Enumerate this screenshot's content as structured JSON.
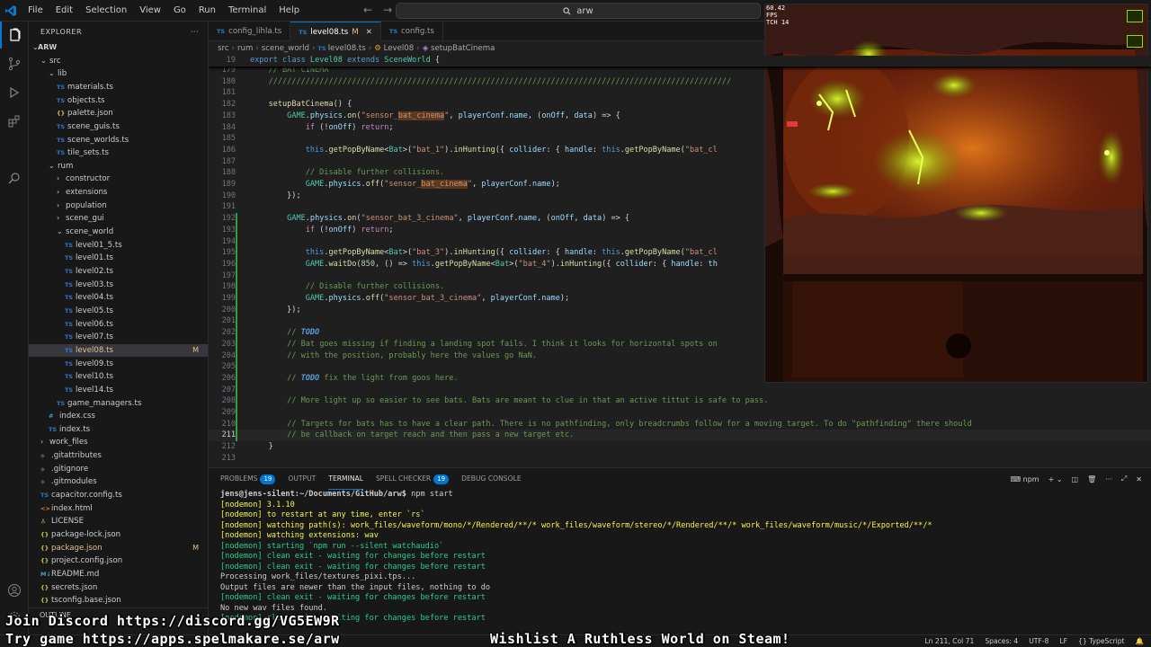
{
  "titlebar": {
    "menu": [
      "File",
      "Edit",
      "Selection",
      "View",
      "Go",
      "Run",
      "Terminal",
      "Help"
    ],
    "search_text": "arw"
  },
  "explorer": {
    "header": "EXPLORER",
    "root": "ARW",
    "items": [
      {
        "label": "src",
        "indent": 1,
        "type": "folder-open"
      },
      {
        "label": "lib",
        "indent": 2,
        "type": "folder-open"
      },
      {
        "label": "materials.ts",
        "indent": 3,
        "type": "ts"
      },
      {
        "label": "objects.ts",
        "indent": 3,
        "type": "ts"
      },
      {
        "label": "palette.json",
        "indent": 3,
        "type": "json"
      },
      {
        "label": "scene_guis.ts",
        "indent": 3,
        "type": "ts"
      },
      {
        "label": "scene_worlds.ts",
        "indent": 3,
        "type": "ts"
      },
      {
        "label": "tile_sets.ts",
        "indent": 3,
        "type": "ts"
      },
      {
        "label": "rum",
        "indent": 2,
        "type": "folder-open"
      },
      {
        "label": "constructor",
        "indent": 3,
        "type": "folder"
      },
      {
        "label": "extensions",
        "indent": 3,
        "type": "folder"
      },
      {
        "label": "population",
        "indent": 3,
        "type": "folder"
      },
      {
        "label": "scene_gui",
        "indent": 3,
        "type": "folder"
      },
      {
        "label": "scene_world",
        "indent": 3,
        "type": "folder-open"
      },
      {
        "label": "level01_5.ts",
        "indent": 4,
        "type": "ts"
      },
      {
        "label": "level01.ts",
        "indent": 4,
        "type": "ts"
      },
      {
        "label": "level02.ts",
        "indent": 4,
        "type": "ts"
      },
      {
        "label": "level03.ts",
        "indent": 4,
        "type": "ts"
      },
      {
        "label": "level04.ts",
        "indent": 4,
        "type": "ts"
      },
      {
        "label": "level05.ts",
        "indent": 4,
        "type": "ts"
      },
      {
        "label": "level06.ts",
        "indent": 4,
        "type": "ts"
      },
      {
        "label": "level07.ts",
        "indent": 4,
        "type": "ts"
      },
      {
        "label": "level08.ts",
        "indent": 4,
        "type": "ts",
        "badge": "M",
        "selected": true
      },
      {
        "label": "level09.ts",
        "indent": 4,
        "type": "ts"
      },
      {
        "label": "level10.ts",
        "indent": 4,
        "type": "ts"
      },
      {
        "label": "level14.ts",
        "indent": 4,
        "type": "ts"
      },
      {
        "label": "game_managers.ts",
        "indent": 3,
        "type": "ts"
      },
      {
        "label": "index.css",
        "indent": 2,
        "type": "css"
      },
      {
        "label": "index.ts",
        "indent": 2,
        "type": "ts"
      },
      {
        "label": "work_files",
        "indent": 1,
        "type": "folder"
      },
      {
        "label": ".gitattributes",
        "indent": 1,
        "type": "git"
      },
      {
        "label": ".gitignore",
        "indent": 1,
        "type": "git"
      },
      {
        "label": ".gitmodules",
        "indent": 1,
        "type": "git"
      },
      {
        "label": "capacitor.config.ts",
        "indent": 1,
        "type": "ts"
      },
      {
        "label": "index.html",
        "indent": 1,
        "type": "html"
      },
      {
        "label": "LICENSE",
        "indent": 1,
        "type": "lic"
      },
      {
        "label": "package-lock.json",
        "indent": 1,
        "type": "json"
      },
      {
        "label": "package.json",
        "indent": 1,
        "type": "json",
        "badge": "M"
      },
      {
        "label": "project.config.json",
        "indent": 1,
        "type": "json"
      },
      {
        "label": "README.md",
        "indent": 1,
        "type": "md"
      },
      {
        "label": "secrets.json",
        "indent": 1,
        "type": "json"
      },
      {
        "label": "tsconfig.base.json",
        "indent": 1,
        "type": "json"
      }
    ],
    "outline": "OUTLINE"
  },
  "tabs": [
    {
      "label": "config_lihla.ts",
      "active": false
    },
    {
      "label": "level08.ts",
      "active": true,
      "modified": "M"
    },
    {
      "label": "config.ts",
      "active": false
    }
  ],
  "breadcrumb": [
    "src",
    "rum",
    "scene_world",
    "level08.ts",
    "Level08",
    "setupBatCinema"
  ],
  "editor": {
    "sticky_line": {
      "num": "19",
      "code": "export class Level08 extends SceneWorld {"
    },
    "lines": [
      {
        "num": "179",
        "code": "    // BAT CINEMA"
      },
      {
        "num": "180",
        "code": "    ////////////////////////////////////////////////////////////////////////////////////////////////////"
      },
      {
        "num": "181",
        "code": ""
      },
      {
        "num": "182",
        "code": "    setupBatCinema() {"
      },
      {
        "num": "183",
        "code": "        GAME.physics.on(\"sensor_bat_cinema\", playerConf.name, (onOff, data) => {"
      },
      {
        "num": "184",
        "code": "            if (!onOff) return;"
      },
      {
        "num": "185",
        "code": ""
      },
      {
        "num": "186",
        "code": "            this.getPopByName<Bat>(\"bat_1\").inHunting({ collider: { handle: this.getPopByName(\"bat_cl"
      },
      {
        "num": "187",
        "code": ""
      },
      {
        "num": "188",
        "code": "            // Disable further collisions."
      },
      {
        "num": "189",
        "code": "            GAME.physics.off(\"sensor_bat_cinema\", playerConf.name);"
      },
      {
        "num": "190",
        "code": "        });"
      },
      {
        "num": "191",
        "code": ""
      },
      {
        "num": "192",
        "code": "        GAME.physics.on(\"sensor_bat_3_cinema\", playerConf.name, (onOff, data) => {"
      },
      {
        "num": "193",
        "code": "            if (!onOff) return;"
      },
      {
        "num": "194",
        "code": ""
      },
      {
        "num": "195",
        "code": "            this.getPopByName<Bat>(\"bat_3\").inHunting({ collider: { handle: this.getPopByName(\"bat_cl"
      },
      {
        "num": "196",
        "code": "            GAME.waitDo(850, () => this.getPopByName<Bat>(\"bat_4\").inHunting({ collider: { handle: th"
      },
      {
        "num": "197",
        "code": ""
      },
      {
        "num": "198",
        "code": "            // Disable further collisions."
      },
      {
        "num": "199",
        "code": "            GAME.physics.off(\"sensor_bat_3_cinema\", playerConf.name);"
      },
      {
        "num": "200",
        "code": "        });"
      },
      {
        "num": "201",
        "code": ""
      },
      {
        "num": "202",
        "code": "        // TODO"
      },
      {
        "num": "203",
        "code": "        // Bat goes missing if finding a landing spot fails. I think it looks for horizontal spots on"
      },
      {
        "num": "204",
        "code": "        // with the position, probably here the values go NaN."
      },
      {
        "num": "205",
        "code": ""
      },
      {
        "num": "206",
        "code": "        // TODO fix the light from goos here."
      },
      {
        "num": "207",
        "code": ""
      },
      {
        "num": "208",
        "code": "        // More light up so easier to see bats. Bats are meant to clue in that an active tittut is safe to pass."
      },
      {
        "num": "209",
        "code": ""
      },
      {
        "num": "210",
        "code": "        // Targets for bats has to have a clear path. There is no pathfinding, only breadcrumbs follow for a moving target. To do \"pathfinding\" there should"
      },
      {
        "num": "211",
        "code": "        // be callback on target reach and then pass a new target etc."
      },
      {
        "num": "212",
        "code": "    }"
      },
      {
        "num": "213",
        "code": ""
      }
    ]
  },
  "game_preview": {
    "fps_line1": "60.42",
    "fps_line2": "FPS",
    "fps_line3": "TCH 14",
    "colors": {
      "lava": "#c0470c",
      "goo": "#b8f500",
      "rock": "#3a1a14"
    }
  },
  "panel": {
    "tabs": [
      {
        "label": "PROBLEMS",
        "badge": "19"
      },
      {
        "label": "OUTPUT"
      },
      {
        "label": "TERMINAL",
        "active": true
      },
      {
        "label": "SPELL CHECKER",
        "badge": "19"
      },
      {
        "label": "DEBUG CONSOLE"
      }
    ],
    "shell_label": "npm",
    "terminal_lines": [
      {
        "text": "jens@jens-silent:~/Documents/GitHub/arw$ npm start",
        "color": "prompt"
      },
      {
        "text": "[nodemon] 3.1.10",
        "color": "y"
      },
      {
        "text": "[nodemon] to restart at any time, enter `rs`",
        "color": "y"
      },
      {
        "text": "[nodemon] watching path(s): work_files/waveform/mono/*/Rendered/**/* work_files/waveform/stereo/*/Rendered/**/* work_files/waveform/music/*/Exported/**/*",
        "color": "y"
      },
      {
        "text": "[nodemon] watching extensions: wav",
        "color": "y"
      },
      {
        "text": "[nodemon] starting `npm run --silent watchaudio`",
        "color": "g"
      },
      {
        "text": "[nodemon] clean exit - waiting for changes before restart",
        "color": "g"
      },
      {
        "text": "[nodemon] clean exit - waiting for changes before restart",
        "color": "g"
      },
      {
        "text": "Processing work_files/textures_pixi.tps...",
        "color": "w"
      },
      {
        "text": "Output files are newer than the input files, nothing to do",
        "color": "w"
      },
      {
        "text": "[nodemon] clean exit - waiting for changes before restart",
        "color": "g"
      },
      {
        "text": "No new wav files found.",
        "color": "w"
      },
      {
        "text": "[nodemon] clean exit - waiting for changes before restart",
        "color": "g"
      }
    ]
  },
  "statusbar": {
    "position": "Ln 211, Col 71",
    "spaces": "Spaces: 4",
    "encoding": "UTF-8",
    "eol": "LF",
    "language": "TypeScript"
  },
  "overlays": {
    "discord": "Join Discord https://discord.gg/VG5EW9R",
    "try_game": "Try game https://apps.spelmakare.se/arw",
    "wishlist": "Wishlist A Ruthless World on Steam!"
  }
}
